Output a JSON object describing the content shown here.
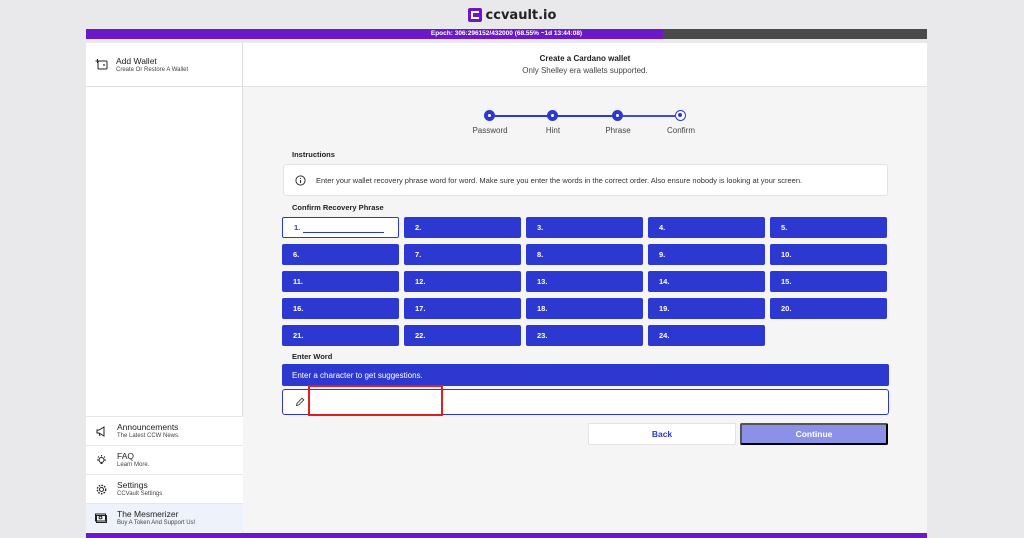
{
  "app": {
    "title": "ccvault.io"
  },
  "epoch": {
    "text": "Epoch: 306:296152/432000 (68.55% ~1d 13:44:08)",
    "progress_percent": 68.55
  },
  "sidebar": {
    "header": {
      "title": "Add Wallet",
      "subtitle": "Create Or Restore A Wallet"
    },
    "items": [
      {
        "title": "Announcements",
        "subtitle": "The Latest CCW News."
      },
      {
        "title": "FAQ",
        "subtitle": "Learn More."
      },
      {
        "title": "Settings",
        "subtitle": "CCVault Settings"
      },
      {
        "title": "The Mesmerizer",
        "subtitle": "Buy A Token And Support Us!"
      }
    ]
  },
  "main": {
    "title": "Create a Cardano wallet",
    "subtitle": "Only Shelley era wallets supported.",
    "steps": [
      {
        "label": "Password",
        "state": "done"
      },
      {
        "label": "Hint",
        "state": "done"
      },
      {
        "label": "Phrase",
        "state": "done"
      },
      {
        "label": "Confirm",
        "state": "current"
      }
    ],
    "instructions_label": "Instructions",
    "instructions_text": "Enter your wallet recovery phrase word for word. Make sure you enter the words in the correct order. Also ensure nobody is looking at your screen.",
    "confirm_label": "Confirm Recovery Phrase",
    "words": [
      "1.",
      "2.",
      "3.",
      "4.",
      "5.",
      "6.",
      "7.",
      "8.",
      "9.",
      "10.",
      "11.",
      "12.",
      "13.",
      "14.",
      "15.",
      "16.",
      "17.",
      "18.",
      "19.",
      "20.",
      "21.",
      "22.",
      "23.",
      "24."
    ],
    "enter_word_label": "Enter Word",
    "suggestion_text": "Enter a character to get suggestions.",
    "word_input_value": "",
    "back_label": "Back",
    "continue_label": "Continue"
  },
  "colors": {
    "accent": "#2d38d1",
    "brand": "#6b18c9",
    "continue_disabled": "#8a91e6",
    "highlight": "#e02020"
  }
}
